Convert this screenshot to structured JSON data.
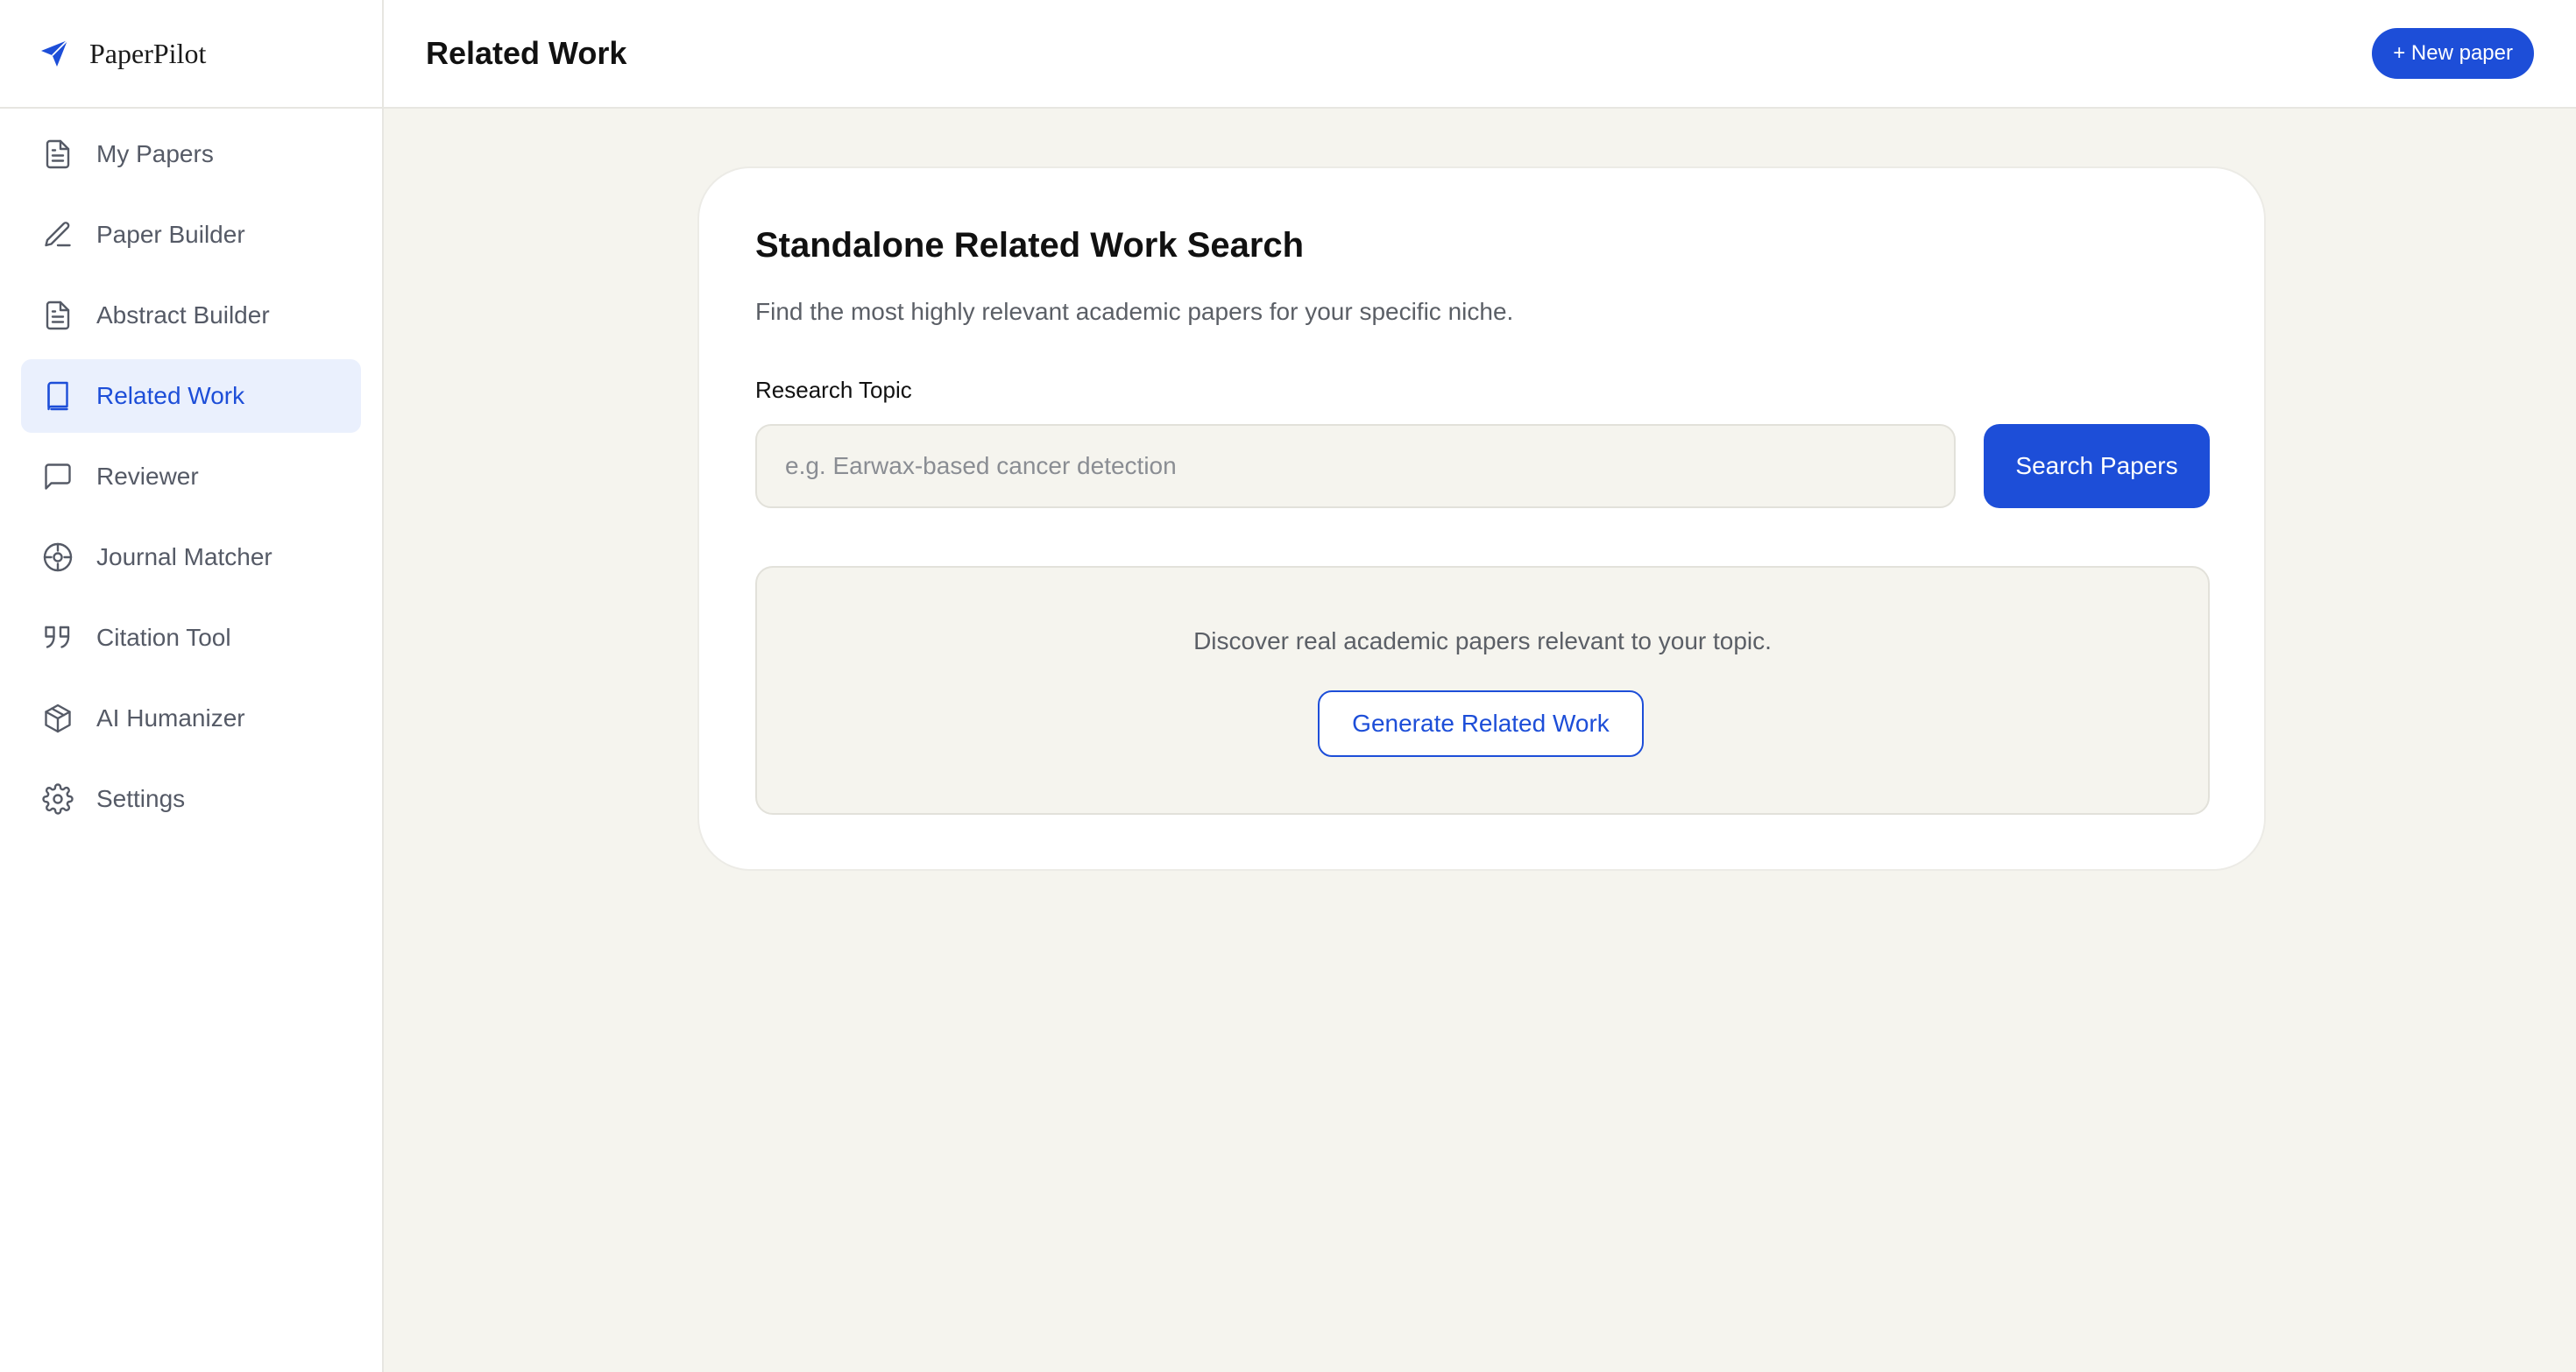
{
  "brand": {
    "name": "PaperPilot",
    "icon": "paper-plane-icon"
  },
  "sidebar": {
    "items": [
      {
        "label": "My Papers",
        "icon": "document-icon"
      },
      {
        "label": "Paper Builder",
        "icon": "pencil-icon"
      },
      {
        "label": "Abstract Builder",
        "icon": "document-icon"
      },
      {
        "label": "Related Work",
        "icon": "book-icon",
        "active": true
      },
      {
        "label": "Reviewer",
        "icon": "chat-bubble-icon"
      },
      {
        "label": "Journal Matcher",
        "icon": "target-icon"
      },
      {
        "label": "Citation Tool",
        "icon": "quote-icon"
      },
      {
        "label": "AI Humanizer",
        "icon": "cube-icon"
      },
      {
        "label": "Settings",
        "icon": "gear-icon"
      }
    ]
  },
  "header": {
    "title": "Related Work",
    "new_paper_label": "+ New paper"
  },
  "main": {
    "card_title": "Standalone Related Work Search",
    "card_subtitle": "Find the most highly relevant academic papers for your specific niche.",
    "field_label": "Research Topic",
    "input_value": "",
    "input_placeholder": "e.g. Earwax-based cancer detection",
    "search_button_label": "Search Papers",
    "empty_text": "Discover real academic papers relevant to your topic.",
    "generate_button_label": "Generate Related Work"
  },
  "colors": {
    "accent": "#1d4ed8",
    "active_bg": "#eaf0fd",
    "page_bg": "#f5f4ee"
  }
}
